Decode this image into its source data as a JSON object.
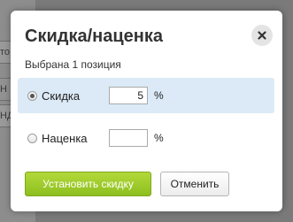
{
  "background": {
    "fragments": [
      "то",
      "Н",
      "НД"
    ]
  },
  "dialog": {
    "title": "Скидка/наценка",
    "subtitle": "Выбрана 1 позиция",
    "options": [
      {
        "label": "Скидка",
        "value": "5",
        "unit": "%",
        "selected": true
      },
      {
        "label": "Наценка",
        "value": "",
        "unit": "%",
        "selected": false
      }
    ],
    "primary_button": "Установить скидку",
    "secondary_button": "Отменить",
    "close_icon": "close-icon"
  },
  "colors": {
    "selected_row": "#dbeaf6",
    "primary_button": "#9cc92a",
    "overlay": "#7a7a7a"
  }
}
